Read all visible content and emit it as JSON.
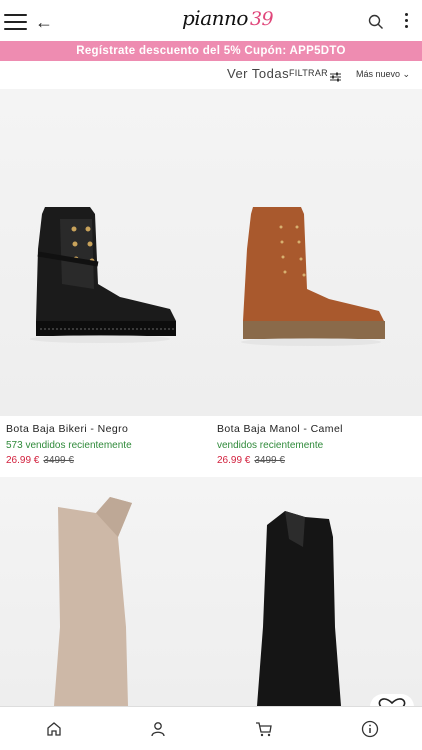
{
  "header": {
    "logo_text": "pianno",
    "logo_number": "39"
  },
  "promo": {
    "text": "Regístrate descuento del 5% Cupón: APP5DTO"
  },
  "toolbar": {
    "view_all": "Ver Todas",
    "filter_label": "FILTRAR",
    "sort_label": "Más nuevo"
  },
  "products": [
    {
      "name": "Bota Baja Bikeri - Negro",
      "sold": "573 vendidos recientemente",
      "price": "26.99 €",
      "old_price": "3499 €"
    },
    {
      "name": "Bota Baja Manol - Camel",
      "sold": "vendidos recientemente",
      "price": "26.99 €",
      "old_price": "3499 €"
    },
    {
      "name": "",
      "sold": "",
      "price": "",
      "old_price": ""
    },
    {
      "name": "",
      "sold": "",
      "price": "",
      "old_price": ""
    }
  ],
  "bottom_nav": [
    "home-icon",
    "user-icon",
    "cart-icon",
    "info-icon"
  ],
  "colors": {
    "promo_bg": "#ee8cb1",
    "price_now": "#d21f3c",
    "sold_text": "#2f8a3a",
    "logo_accent": "#e0467a"
  }
}
